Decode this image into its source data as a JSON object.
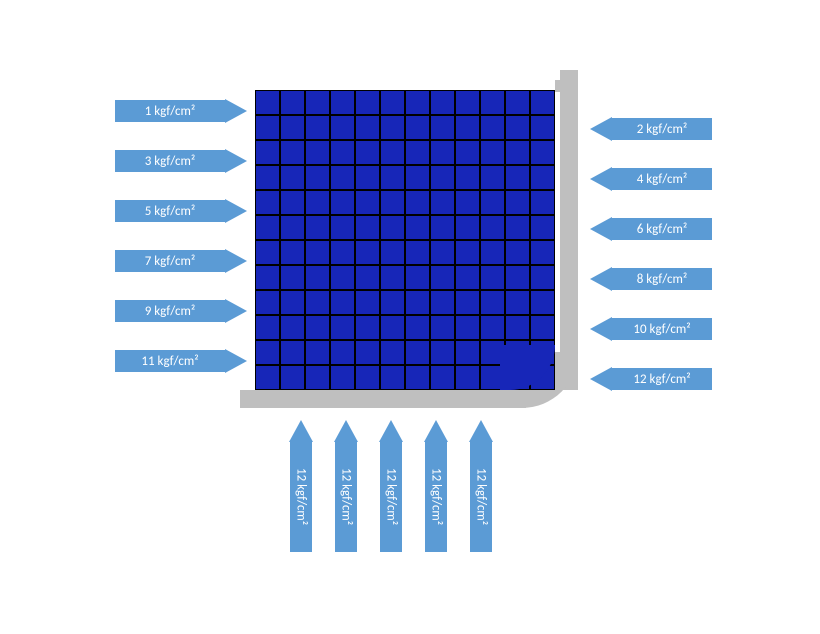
{
  "left_arrows": [
    "1 kgf/cm²",
    "3 kgf/cm²",
    "5 kgf/cm²",
    "7 kgf/cm²",
    "9 kgf/cm²",
    "11 kgf/cm²"
  ],
  "right_arrows": [
    "2 kgf/cm²",
    "4 kgf/cm²",
    "6 kgf/cm²",
    "8 kgf/cm²",
    "10 kgf/cm²",
    "12 kgf/cm²"
  ],
  "bottom_arrows": [
    "12 kgf/cm²",
    "12 kgf/cm²",
    "12 kgf/cm²",
    "12 kgf/cm²",
    "12 kgf/cm²"
  ],
  "mesh": {
    "rows": 12,
    "cols": 12,
    "fill": "#1726b8"
  },
  "chart_data": {
    "type": "diagram",
    "description": "Finite-element / soil-wall mesh with distributed pressure arrows on left, right and bottom faces.",
    "mesh": {
      "rows": 12,
      "cols": 12
    },
    "left_pressures_kgf_cm2": [
      1,
      3,
      5,
      7,
      9,
      11
    ],
    "right_pressures_kgf_cm2": [
      2,
      4,
      6,
      8,
      10,
      12
    ],
    "bottom_pressures_kgf_cm2": [
      12,
      12,
      12,
      12,
      12
    ],
    "unit": "kgf/cm²"
  }
}
